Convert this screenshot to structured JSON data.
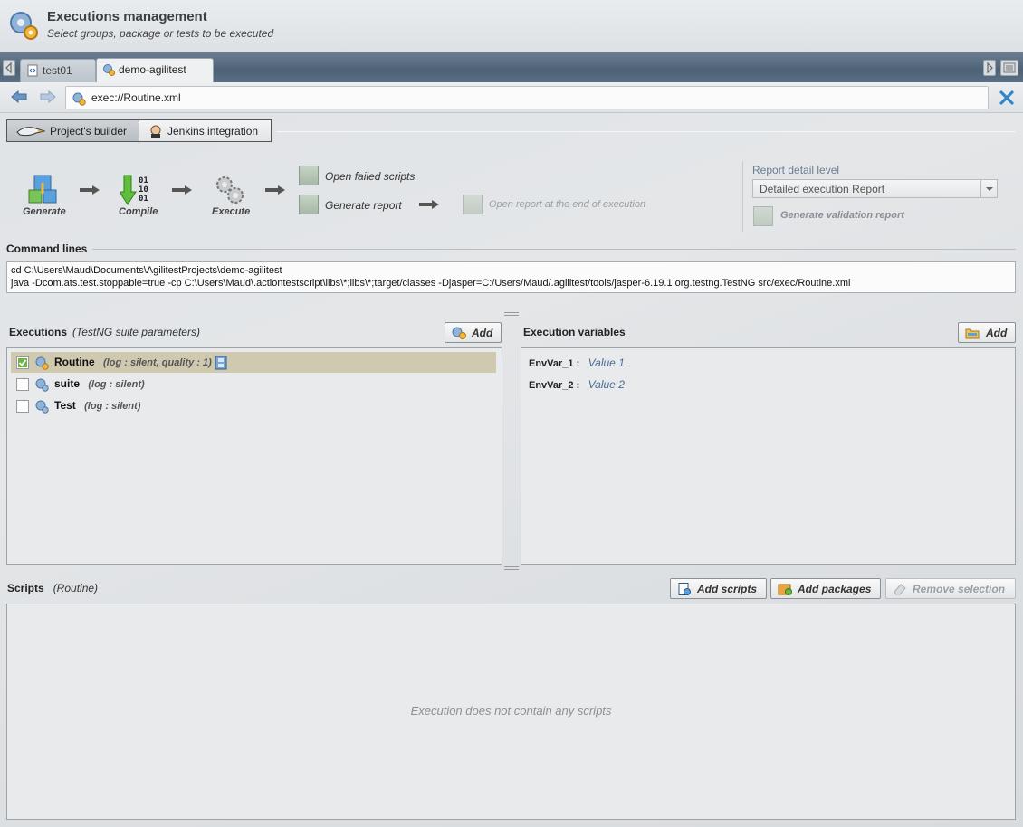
{
  "header": {
    "title": "Executions management",
    "subtitle": "Select groups, package or tests to be executed"
  },
  "tabs": [
    {
      "label": "test01",
      "icon": "script-file-icon",
      "active": false
    },
    {
      "label": "demo-agilitest",
      "icon": "gears-icon",
      "active": true
    }
  ],
  "address": {
    "value": "exec://Routine.xml"
  },
  "builder_tabs": {
    "builder_label": "Project's builder",
    "jenkins_label": "Jenkins integration"
  },
  "pipeline": {
    "generate_label": "Generate",
    "compile_label": "Compile",
    "execute_label": "Execute",
    "open_failed_label": "Open failed scripts",
    "generate_report_label": "Generate report",
    "open_report_label": "Open  report at the end of execution"
  },
  "report": {
    "level_label": "Report detail level",
    "selected": "Detailed execution Report",
    "validation_label": "Generate validation report"
  },
  "command": {
    "title": "Command lines",
    "line1": "cd C:\\Users\\Maud\\Documents\\AgilitestProjects\\demo-agilitest",
    "line2": "java -Dcom.ats.test.stoppable=true -cp C:\\Users\\Maud\\.actiontestscript\\libs\\*;libs\\*;target/classes -Djasper=C:/Users/Maud/.agilitest/tools/jasper-6.19.1 org.testng.TestNG src/exec/Routine.xml"
  },
  "executions": {
    "title": "Executions",
    "subtitle": "(TestNG suite parameters)",
    "add_label": "Add",
    "items": [
      {
        "name": "Routine",
        "meta": "(log : silent, quality : 1)",
        "checked": true
      },
      {
        "name": "suite",
        "meta": "(log : silent)",
        "checked": false
      },
      {
        "name": "Test",
        "meta": "(log : silent)",
        "checked": false
      }
    ]
  },
  "variables": {
    "title": "Execution variables",
    "add_label": "Add",
    "items": [
      {
        "name": "EnvVar_1 :",
        "value": "Value 1"
      },
      {
        "name": "EnvVar_2 :",
        "value": "Value 2"
      }
    ]
  },
  "scripts": {
    "title": "Scripts",
    "subtitle": "(Routine)",
    "add_scripts_label": "Add scripts",
    "add_packages_label": "Add packages",
    "remove_label": "Remove selection",
    "empty_message": "Execution does not contain any scripts"
  },
  "colors": {
    "tabstrip": "#5b6f84",
    "selected_row": "#cfc9b0",
    "variable_value": "#4a6a96",
    "close_icon": "#2f86c9"
  }
}
